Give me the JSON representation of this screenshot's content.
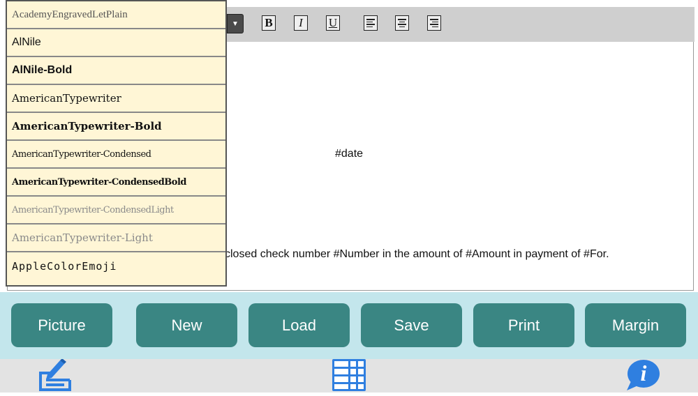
{
  "toolbar": {
    "font_dropdown_arrow": "▼",
    "bold_label": "B",
    "italic_label": "I",
    "underline_label": "U",
    "align_icons": [
      "align-left-icon",
      "align-center-icon",
      "align-right-icon"
    ]
  },
  "font_list": [
    "AcademyEngravedLetPlain",
    "AlNile",
    "AlNile-Bold",
    "AmericanTypewriter",
    "AmericanTypewriter-Bold",
    "AmericanTypewriter-Condensed",
    "AmericanTypewriter-CondensedBold",
    "AmericanTypewriter-CondensedLight",
    "AmericanTypewriter-Light",
    "AppleColorEmoji"
  ],
  "editor": {
    "date_token": "#date",
    "body_text": "closed check number #Number in the amount of #Amount in payment of #For."
  },
  "buttons": {
    "picture": "Picture",
    "new": "New",
    "load": "Load",
    "save": "Save",
    "print": "Print",
    "margin": "Margin"
  },
  "tabbar": {
    "left_icon": "edit-form-icon",
    "center_icon": "calculator-icon",
    "right_icon": "info-icon",
    "info_glyph": "i"
  },
  "colors": {
    "button_bg": "#3a8683",
    "button_bar_bg": "#c3e6ec",
    "dropdown_bg": "#fff6d6",
    "icon_blue": "#2f7fe0"
  }
}
